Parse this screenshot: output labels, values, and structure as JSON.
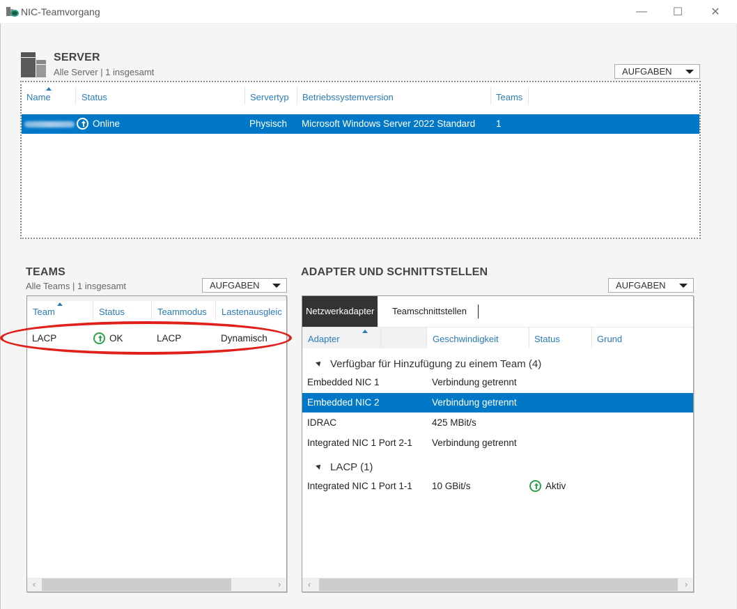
{
  "window": {
    "title": "NIC-Teamvorgang",
    "app_icon": "nic-teaming-icon",
    "controls": {
      "minimize": "—",
      "maximize": "☐",
      "close": "✕"
    }
  },
  "server": {
    "title": "SERVER",
    "subtitle": "Alle Server | 1 insgesamt",
    "icon": "server-icon",
    "tasks_label": "AUFGABEN",
    "columns": [
      "Name",
      "Status",
      "Servertyp",
      "Betriebssystemversion",
      "Teams"
    ],
    "sort_column": "Name",
    "rows": [
      {
        "name": "",
        "name_obscured": true,
        "status": "Online",
        "status_icon": "arrow-up-circle-icon",
        "type": "Physisch",
        "os": "Microsoft Windows Server 2022 Standard",
        "teams": "1",
        "selected": true
      }
    ]
  },
  "teams": {
    "title": "TEAMS",
    "subtitle": "Alle Teams | 1 insgesamt",
    "tasks_label": "AUFGABEN",
    "columns": [
      "Team",
      "Status",
      "Teammodus",
      "Lastenausgleic"
    ],
    "sort_column": "Team",
    "rows": [
      {
        "team": "LACP",
        "status": "OK",
        "status_icon": "arrow-up-circle-icon",
        "mode": "LACP",
        "load_balancing": "Dynamisch",
        "highlighted": true
      }
    ],
    "scroll_arrows": {
      "left": "‹",
      "right": "›"
    }
  },
  "adapters": {
    "title": "ADAPTER UND SCHNITTSTELLEN",
    "tasks_label": "AUFGABEN",
    "tabs": [
      {
        "label": "Netzwerkadapter",
        "active": true
      },
      {
        "label": "Teamschnittstellen",
        "active": false
      }
    ],
    "columns": [
      "Adapter",
      "Geschwindigkeit",
      "Status",
      "Grund"
    ],
    "sort_column": "Adapter",
    "groups": [
      {
        "label": "Verfügbar für Hinzufügung zu einem Team (4)",
        "rows": [
          {
            "adapter": "Embedded NIC 1",
            "speed": "Verbindung getrennt",
            "status": "",
            "selected": false
          },
          {
            "adapter": "Embedded NIC 2",
            "speed": "Verbindung getrennt",
            "status": "",
            "selected": true
          },
          {
            "adapter": "IDRAC",
            "speed": "425 MBit/s",
            "status": "",
            "selected": false
          },
          {
            "adapter": "Integrated NIC 1 Port 2-1",
            "speed": "Verbindung getrennt",
            "status": "",
            "selected": false
          }
        ]
      },
      {
        "label": "LACP (1)",
        "rows": [
          {
            "adapter": "Integrated NIC 1 Port 1-1",
            "speed": "10 GBit/s",
            "status": "Aktiv",
            "status_icon": "arrow-up-circle-icon",
            "selected": false
          }
        ]
      }
    ],
    "scroll_arrows": {
      "left": "‹",
      "right": "›"
    }
  },
  "colors": {
    "selection": "#0078c8",
    "header_text": "#2b7bb9",
    "status_ok": "#2da24b",
    "annotation": "#e0201a"
  }
}
